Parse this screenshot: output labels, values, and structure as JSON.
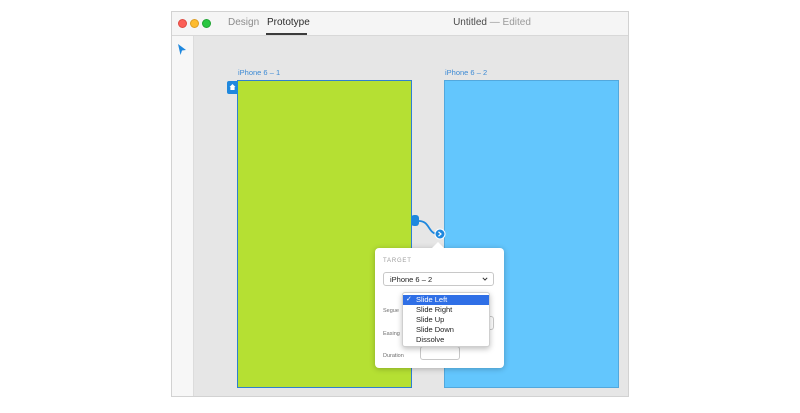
{
  "titlebar": {
    "tabs": [
      {
        "label": "Design"
      },
      {
        "label": "Prototype"
      }
    ],
    "doc_name": "Untitled",
    "doc_status": "— Edited"
  },
  "artboards": [
    {
      "label": "iPhone 6 – 1",
      "color": "#b5e033"
    },
    {
      "label": "iPhone 6 – 2",
      "color": "#63c6fd"
    }
  ],
  "popover": {
    "heading": "TARGET",
    "target_value": "iPhone 6 – 2",
    "segue_label": "Segue",
    "easing_label": "Easing",
    "duration_label": "Duration"
  },
  "segue_dropdown": {
    "check": "✓",
    "options": [
      {
        "label": "Slide Left",
        "selected": true
      },
      {
        "label": "Slide Right"
      },
      {
        "label": "Slide Up"
      },
      {
        "label": "Slide Down"
      },
      {
        "label": "Dissolve"
      }
    ]
  },
  "colors": {
    "accent": "#2f6fe6",
    "wire": "#1f88de"
  }
}
